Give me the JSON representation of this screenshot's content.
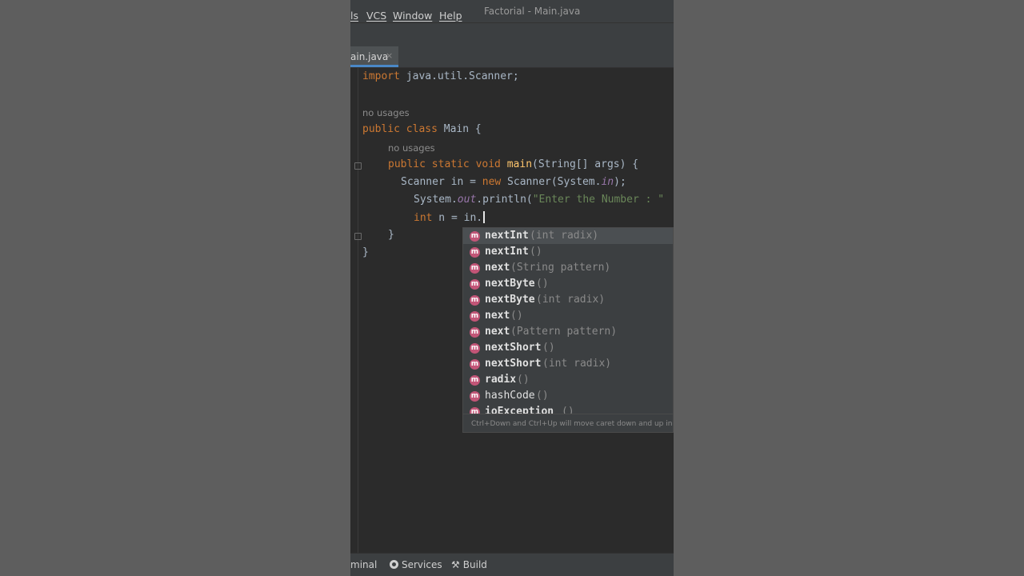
{
  "menu": {
    "tools_partial": "ls",
    "vcs": "VCS",
    "window": "Window",
    "help": "Help",
    "window_title": "Factorial - Main.java"
  },
  "tab": {
    "label": "ain.java",
    "close": "×"
  },
  "editor": {
    "line1": {
      "kw": "import",
      "rest": " java.util.Scanner;"
    },
    "hint1": "no usages",
    "line2": {
      "kw": "public class",
      "rest": " Main {"
    },
    "hint2": "no usages",
    "line3": {
      "kw": "public static void",
      "fn": "main",
      "rest": "(String[] args) {"
    },
    "line4": {
      "p1": "Scanner in = ",
      "kw": "new",
      "p2": " Scanner(System.",
      "stat": "in",
      "p3": ");"
    },
    "line5": {
      "p1": "System.",
      "stat": "out",
      "p2": ".println(",
      "str": "\"Enter the Number : \""
    },
    "line6": {
      "kw": "int",
      "rest": " n = in."
    },
    "line7": "}",
    "line8": "}"
  },
  "completion": {
    "items": [
      {
        "icon": "m",
        "name": "nextInt",
        "sig": "(int radix)"
      },
      {
        "icon": "m",
        "name": "nextInt",
        "sig": "()"
      },
      {
        "icon": "m",
        "name": "next",
        "sig": "(String pattern)"
      },
      {
        "icon": "m",
        "name": "nextByte",
        "sig": "()"
      },
      {
        "icon": "m",
        "name": "nextByte",
        "sig": "(int radix)"
      },
      {
        "icon": "m",
        "name": "next",
        "sig": "()"
      },
      {
        "icon": "m",
        "name": "next",
        "sig": "(Pattern pattern)"
      },
      {
        "icon": "m",
        "name": "nextShort",
        "sig": "()"
      },
      {
        "icon": "m",
        "name": "nextShort",
        "sig": "(int radix)"
      },
      {
        "icon": "m",
        "name": "radix",
        "sig": "()"
      },
      {
        "icon": "m",
        "name": "hashCode",
        "sig": "()"
      },
      {
        "icon": "m",
        "name": "ioException",
        "sig": "()"
      }
    ],
    "footer": "Ctrl+Down and Ctrl+Up will move caret down and up in t"
  },
  "statusbar": {
    "terminal": "minal",
    "services": "Services",
    "build": "Build"
  },
  "colors": {
    "keyword": "#cc7832",
    "method": "#ffc66d",
    "string": "#6a8759",
    "static_field": "#9876aa",
    "method_icon": "#c25577"
  }
}
